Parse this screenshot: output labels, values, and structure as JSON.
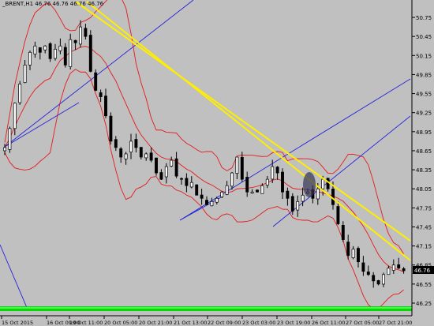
{
  "chart_data": {
    "type": "candlestick",
    "title": "_BRENT,H1  46.76 46.76 46.76 46.76",
    "symbol": "_BRENT,H1",
    "ohlc_header": [
      "46.76",
      "46.76",
      "46.76",
      "46.76"
    ],
    "current_price": "46.76",
    "ylim": [
      46.25,
      50.85
    ],
    "y_ticks": [
      "50.75",
      "50.45",
      "50.15",
      "49.85",
      "49.55",
      "49.25",
      "48.95",
      "48.65",
      "48.35",
      "48.05",
      "47.75",
      "47.45",
      "47.15",
      "46.85",
      "46.55",
      "46.25"
    ],
    "x_ticks": [
      "15 Oct 2015",
      "16 Oct 09:00",
      "19 Oct 11:00",
      "20 Oct 05:00",
      "20 Oct 21:00",
      "21 Oct 13:00",
      "22 Oct 09:00",
      "23 Oct 03:00",
      "23 Oct 19:00",
      "26 Oct 11:00",
      "27 Oct 05:00",
      "27 Oct 21:00"
    ],
    "close_series": [
      48.7,
      49.0,
      49.4,
      49.7,
      50.0,
      50.2,
      50.3,
      50.2,
      50.3,
      50.1,
      50.25,
      50.3,
      50.0,
      50.4,
      50.35,
      50.6,
      50.45,
      49.9,
      49.6,
      49.5,
      49.2,
      48.8,
      48.7,
      48.55,
      48.6,
      48.8,
      48.7,
      48.55,
      48.6,
      48.5,
      48.3,
      48.2,
      48.4,
      48.5,
      48.25,
      48.2,
      48.1,
      48.15,
      47.95,
      47.9,
      47.8,
      47.85,
      47.9,
      48.0,
      48.1,
      48.3,
      48.55,
      48.2,
      48.0,
      48.0,
      48.0,
      48.1,
      48.2,
      48.4,
      48.3,
      48.0,
      47.9,
      47.7,
      47.85,
      47.95,
      48.0,
      47.9,
      48.05,
      48.2,
      48.05,
      47.8,
      47.5,
      47.25,
      47.0,
      47.1,
      46.9,
      46.75,
      46.7,
      46.6,
      46.55,
      46.7,
      46.8,
      46.85,
      46.8,
      46.76
    ],
    "series": [
      {
        "name": "price",
        "color": "#000000"
      },
      {
        "name": "bollinger",
        "color": "#e41a1c"
      },
      {
        "name": "trend-channel",
        "color": "#2222dd"
      },
      {
        "name": "resistance-channel",
        "color": "#ffee00"
      }
    ],
    "grid": false
  }
}
